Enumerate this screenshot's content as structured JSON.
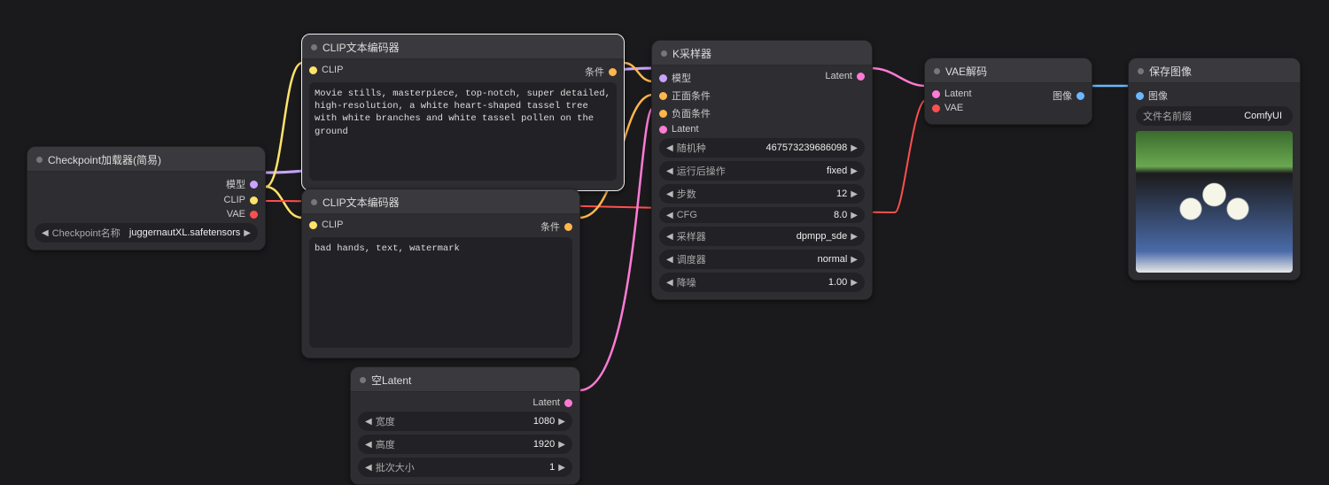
{
  "nodes": {
    "checkpoint": {
      "title": "Checkpoint加载器(简易)",
      "outputs": {
        "model": "模型",
        "clip": "CLIP",
        "vae": "VAE"
      },
      "widget_name_label": "Checkpoint名称",
      "widget_name_value": "juggernautXL.safetensors"
    },
    "clip_pos": {
      "title": "CLIP文本编码器",
      "input_clip": "CLIP",
      "output_cond": "条件",
      "text": "Movie stills, masterpiece, top-notch, super detailed, high-resolution, a white heart-shaped tassel tree with white branches and white tassel pollen on the ground"
    },
    "clip_neg": {
      "title": "CLIP文本编码器",
      "input_clip": "CLIP",
      "output_cond": "条件",
      "text": "bad hands, text, watermark"
    },
    "empty_latent": {
      "title": "空Latent",
      "output_latent": "Latent",
      "width_label": "宽度",
      "width_value": "1080",
      "height_label": "高度",
      "height_value": "1920",
      "batch_label": "批次大小",
      "batch_value": "1"
    },
    "ksampler": {
      "title": "K采样器",
      "in_model": "模型",
      "in_pos": "正面条件",
      "in_neg": "负面条件",
      "in_latent": "Latent",
      "out_latent": "Latent",
      "seed_label": "随机种",
      "seed_value": "467573239686098",
      "after_label": "运行后操作",
      "after_value": "fixed",
      "steps_label": "步数",
      "steps_value": "12",
      "cfg_label": "CFG",
      "cfg_value": "8.0",
      "sampler_label": "采样器",
      "sampler_value": "dpmpp_sde",
      "scheduler_label": "调度器",
      "scheduler_value": "normal",
      "denoise_label": "降噪",
      "denoise_value": "1.00"
    },
    "vae_decode": {
      "title": "VAE解码",
      "in_latent": "Latent",
      "in_vae": "VAE",
      "out_image": "图像"
    },
    "save_image": {
      "title": "保存图像",
      "in_image": "图像",
      "prefix_label": "文件名前缀",
      "prefix_value": "ComfyUI"
    }
  }
}
